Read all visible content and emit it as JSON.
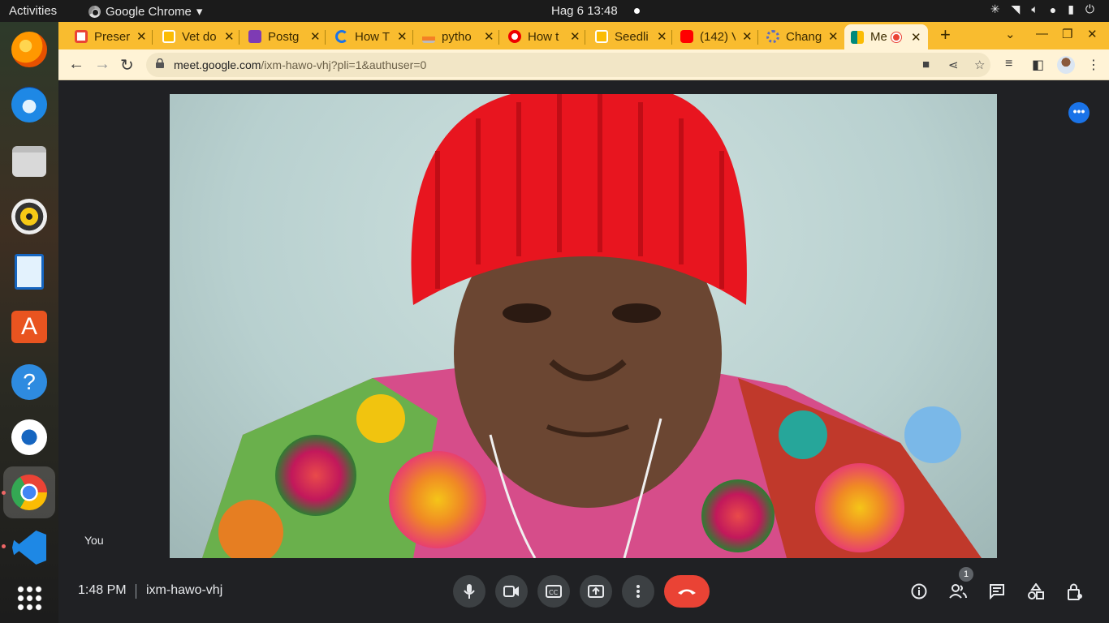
{
  "topbar": {
    "activities": "Activities",
    "app_name": "Google Chrome",
    "app_menu_arrow": "▾",
    "datetime": "Hag 6  13:48",
    "tray_icons": [
      "slack-icon",
      "wifi-icon",
      "volume-icon",
      "microphone-icon",
      "battery-icon",
      "power-icon"
    ]
  },
  "dock": {
    "apps": [
      "Firefox",
      "Thunderbird",
      "Files",
      "Rhythmbox",
      "LibreOffice Writer",
      "Ubuntu Software",
      "Help",
      "Android Studio",
      "Google Chrome",
      "Visual Studio Code",
      "Show Applications"
    ]
  },
  "tabs": [
    {
      "label": "Preser",
      "icon": "gmail-icon",
      "color": "#ea4335"
    },
    {
      "label": "Vet do",
      "icon": "slides-icon",
      "color": "#fbbc04"
    },
    {
      "label": "Postg",
      "icon": "forms-icon",
      "color": "#7e3bb4"
    },
    {
      "label": "How T",
      "icon": "loading-icon",
      "color": "#1a73e8"
    },
    {
      "label": "pytho",
      "icon": "stackoverflow-icon",
      "color": "#f48024"
    },
    {
      "label": "How t",
      "icon": "opera-icon",
      "color": "#e00"
    },
    {
      "label": "Seedli",
      "icon": "slides-icon",
      "color": "#fbbc04"
    },
    {
      "label": "(142) V",
      "icon": "youtube-icon",
      "color": "#f00"
    },
    {
      "label": "Chang",
      "icon": "settings-icon",
      "color": "#5c6bc0"
    },
    {
      "label": "Me",
      "icon": "meet-icon",
      "color": "#00897b",
      "active": true
    }
  ],
  "tab_close": "✕",
  "new_tab": "+",
  "window_controls": {
    "tab_search": "⌄",
    "minimize": "—",
    "maximize": "❐",
    "close": "✕"
  },
  "toolbar": {
    "url_host": "meet.google.com",
    "url_rest": "/ixm-hawo-vhj?pli=1&authuser=0",
    "back": "←",
    "forward": "→",
    "reload": "↻"
  },
  "meet": {
    "participant_label": "You",
    "time": "1:48 PM",
    "meeting_code": "ixm-hawo-vhj",
    "participants_count": "1",
    "more_options": "•••"
  },
  "colors": {
    "tab_bar": "#f9bc2f",
    "toolbar": "#fff3d6",
    "meet_bg": "#202124",
    "end_call": "#ea4335",
    "control_bg": "#3c4043"
  }
}
